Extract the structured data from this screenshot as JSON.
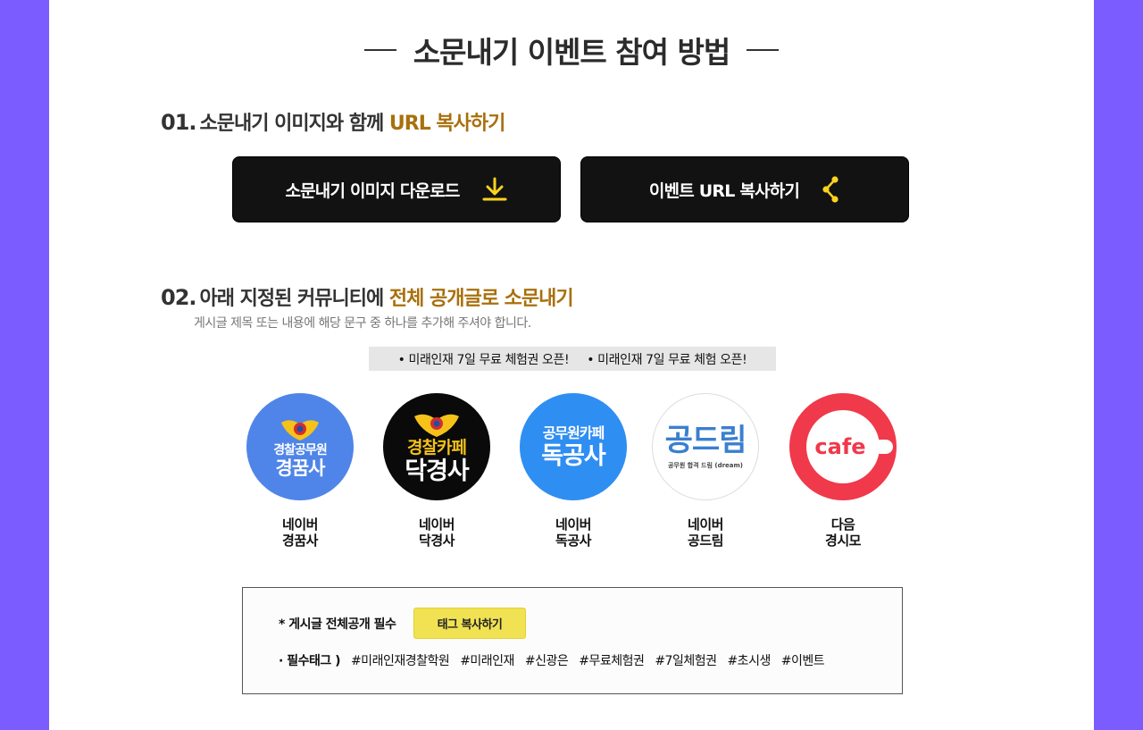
{
  "title": "소문내기 이벤트 참여 방법",
  "step1": {
    "num": "01.",
    "text": "소문내기 이미지와 함께",
    "highlight": "URL 복사하기"
  },
  "buttons": {
    "download": "소문내기 이미지 다운로드",
    "copy_url": "이벤트 URL 복사하기"
  },
  "step2": {
    "num": "02.",
    "text": "아래 지정된 커뮤니티에",
    "highlight": "전체 공개글로 소문내기",
    "note": "게시글 제목 또는 내용에 해당 문구 중 하나를 추가해 주셔야 합니다."
  },
  "phrases": [
    "• 미래인재 7일 무료 체험권 오픈!",
    "• 미래인재 7일 무료 체험 오픈!"
  ],
  "communities": [
    {
      "platform": "네이버",
      "name": "경꿈사",
      "logo_top": "경찰공무원",
      "logo_main": "경꿈사",
      "color": "#4f85e8"
    },
    {
      "platform": "네이버",
      "name": "닥경사",
      "logo_top": "경찰카페",
      "logo_main": "닥경사",
      "color": "#0a0a0a"
    },
    {
      "platform": "네이버",
      "name": "독공사",
      "logo_top": "공무원카페",
      "logo_main": "독공사",
      "color": "#2f8ef2"
    },
    {
      "platform": "네이버",
      "name": "공드림",
      "logo_top": "공드림",
      "logo_main": "공무원 합격 드림 (dream)",
      "color": "#ffffff"
    },
    {
      "platform": "다음",
      "name": "경시모",
      "logo_main": "cafe",
      "color": "#f0394b"
    }
  ],
  "tagbox": {
    "required": "* 게시글 전체공개 필수",
    "copy_button": "태그 복사하기",
    "tags_label": "· 필수태그 )",
    "tags": [
      "#미래인재경찰학원",
      "#미래인재",
      "#신광은",
      "#무료체험권",
      "#7일체험권",
      "#초시생",
      "#이벤트"
    ]
  },
  "colors": {
    "accent": "#a8700c",
    "icon_yellow": "#ffd21f",
    "side_bg": "#7b5cff",
    "button_bg": "#121212"
  }
}
